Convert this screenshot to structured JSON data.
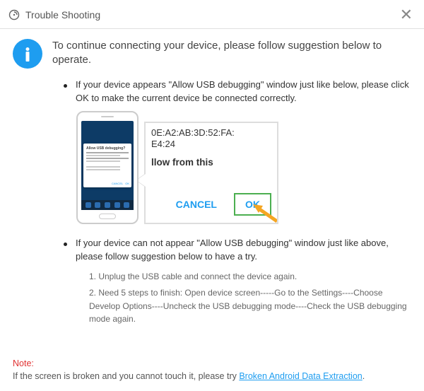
{
  "titlebar": {
    "title": "Trouble Shooting"
  },
  "heading": "To continue connecting your device, please follow suggestion below to operate.",
  "bullet1": "If your device appears \"Allow USB debugging\" window just like below, please click OK to make the current device  be connected correctly.",
  "bullet2": "If your device can not appear \"Allow USB debugging\" window just like above, please follow suggestion below to have a try.",
  "steps": {
    "s1": "1. Unplug the USB cable and connect the device again.",
    "s2": "2. Need 5 steps to finish: Open device screen-----Go to the Settings----Choose Develop Options----Uncheck the USB debugging mode----Check the USB debugging mode again."
  },
  "zoom": {
    "mac1": "0E:A2:AB:3D:52:FA:",
    "mac2": "E4:24",
    "question": "llow from this",
    "cancel": "CANCEL",
    "ok": "OK"
  },
  "phone_popup": {
    "title": "Allow USB debugging?"
  },
  "note": {
    "title": "Note:",
    "body_prefix": "If the screen is broken and you cannot touch it, please try ",
    "link": "Broken Android Data Extraction",
    "body_suffix": "."
  }
}
